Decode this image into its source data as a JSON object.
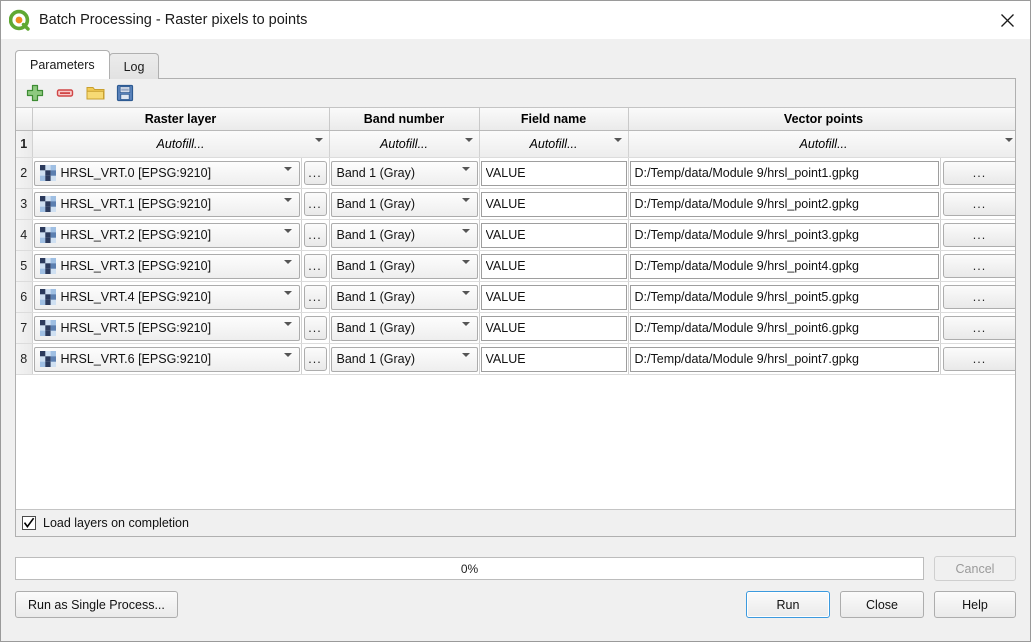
{
  "window": {
    "title": "Batch Processing - Raster pixels to points",
    "logo_icon": "qgis-logo-icon",
    "close_icon": "close-icon"
  },
  "tabs": [
    {
      "label": "Parameters",
      "active": true
    },
    {
      "label": "Log",
      "active": false
    }
  ],
  "toolbar": [
    {
      "name": "add-row-button",
      "icon": "plus-icon",
      "color": "#3d9b35"
    },
    {
      "name": "remove-row-button",
      "icon": "minus-icon",
      "color": "#d84b4b"
    },
    {
      "name": "open-button",
      "icon": "folder-icon",
      "color": "#f0c341"
    },
    {
      "name": "save-button",
      "icon": "floppy-disk-icon",
      "color": "#3b6fb0"
    }
  ],
  "table": {
    "headers": [
      "Raster layer",
      "Band number",
      "Field name",
      "Vector points"
    ],
    "autofill": {
      "row_number": "1",
      "raster_layer": "Autofill...",
      "band_number": "Autofill...",
      "field_name": "Autofill...",
      "vector_points": "Autofill..."
    },
    "browse_label": "...",
    "rows": [
      {
        "n": "2",
        "raster_layer": "HRSL_VRT.0 [EPSG:9210]",
        "band_number": "Band 1 (Gray)",
        "field_name": "VALUE",
        "vector_points": "D:/Temp/data/Module 9/hrsl_point1.gpkg"
      },
      {
        "n": "3",
        "raster_layer": "HRSL_VRT.1 [EPSG:9210]",
        "band_number": "Band 1 (Gray)",
        "field_name": "VALUE",
        "vector_points": "D:/Temp/data/Module 9/hrsl_point2.gpkg"
      },
      {
        "n": "4",
        "raster_layer": "HRSL_VRT.2 [EPSG:9210]",
        "band_number": "Band 1 (Gray)",
        "field_name": "VALUE",
        "vector_points": "D:/Temp/data/Module 9/hrsl_point3.gpkg"
      },
      {
        "n": "5",
        "raster_layer": "HRSL_VRT.3 [EPSG:9210]",
        "band_number": "Band 1 (Gray)",
        "field_name": "VALUE",
        "vector_points": "D:/Temp/data/Module 9/hrsl_point4.gpkg"
      },
      {
        "n": "6",
        "raster_layer": "HRSL_VRT.4 [EPSG:9210]",
        "band_number": "Band 1 (Gray)",
        "field_name": "VALUE",
        "vector_points": "D:/Temp/data/Module 9/hrsl_point5.gpkg"
      },
      {
        "n": "7",
        "raster_layer": "HRSL_VRT.5 [EPSG:9210]",
        "band_number": "Band 1 (Gray)",
        "field_name": "VALUE",
        "vector_points": "D:/Temp/data/Module 9/hrsl_point6.gpkg"
      },
      {
        "n": "8",
        "raster_layer": "HRSL_VRT.6 [EPSG:9210]",
        "band_number": "Band 1 (Gray)",
        "field_name": "VALUE",
        "vector_points": "D:/Temp/data/Module 9/hrsl_point7.gpkg"
      }
    ]
  },
  "options": {
    "load_layers_label": "Load layers on completion",
    "load_layers_checked": true
  },
  "progress": {
    "value_label": "0%",
    "percent": 0,
    "cancel_label": "Cancel",
    "cancel_enabled": false
  },
  "buttons": {
    "run_as_single": "Run as Single Process...",
    "run": "Run",
    "close": "Close",
    "help": "Help"
  },
  "colors": {
    "accent_focus": "#3c9ade",
    "dialog_bg": "#f0f0f0",
    "table_bg": "#ffffff"
  }
}
